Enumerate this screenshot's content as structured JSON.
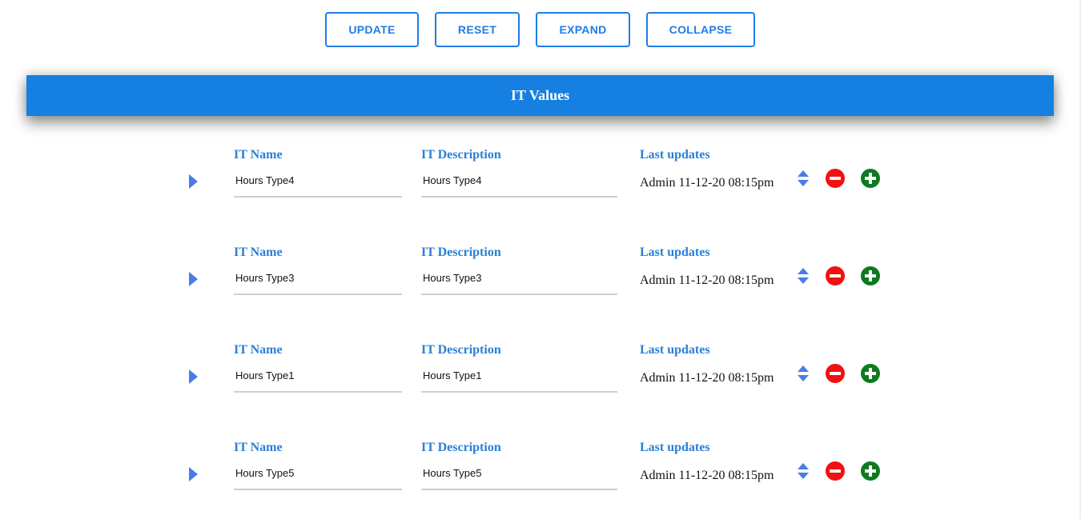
{
  "toolbar": {
    "buttons": [
      {
        "label": "UPDATE"
      },
      {
        "label": "RESET"
      },
      {
        "label": "EXPAND"
      },
      {
        "label": "COLLAPSE"
      }
    ]
  },
  "panel": {
    "title": "IT Values"
  },
  "columns": {
    "name": "IT Name",
    "description": "IT Description",
    "updated": "Last updates"
  },
  "rows": [
    {
      "name": "Hours Type4",
      "description": "Hours Type4",
      "updated": "Admin 11-12-20 08:15pm"
    },
    {
      "name": "Hours Type3",
      "description": "Hours Type3",
      "updated": "Admin 11-12-20 08:15pm"
    },
    {
      "name": "Hours Type1",
      "description": "Hours Type1",
      "updated": "Admin 11-12-20 08:15pm"
    },
    {
      "name": "Hours Type5",
      "description": "Hours Type5",
      "updated": "Admin 11-12-20 08:15pm"
    }
  ],
  "icons": {
    "expander": "caret-right-icon",
    "sort": "sort-icon",
    "remove": "minus-circle-icon",
    "add": "plus-circle-icon"
  },
  "colors": {
    "accent": "#1580e2",
    "label": "#2a7fd6",
    "remove": "#f21010",
    "add": "#0d7a1f",
    "expander": "#4a7ce8"
  }
}
